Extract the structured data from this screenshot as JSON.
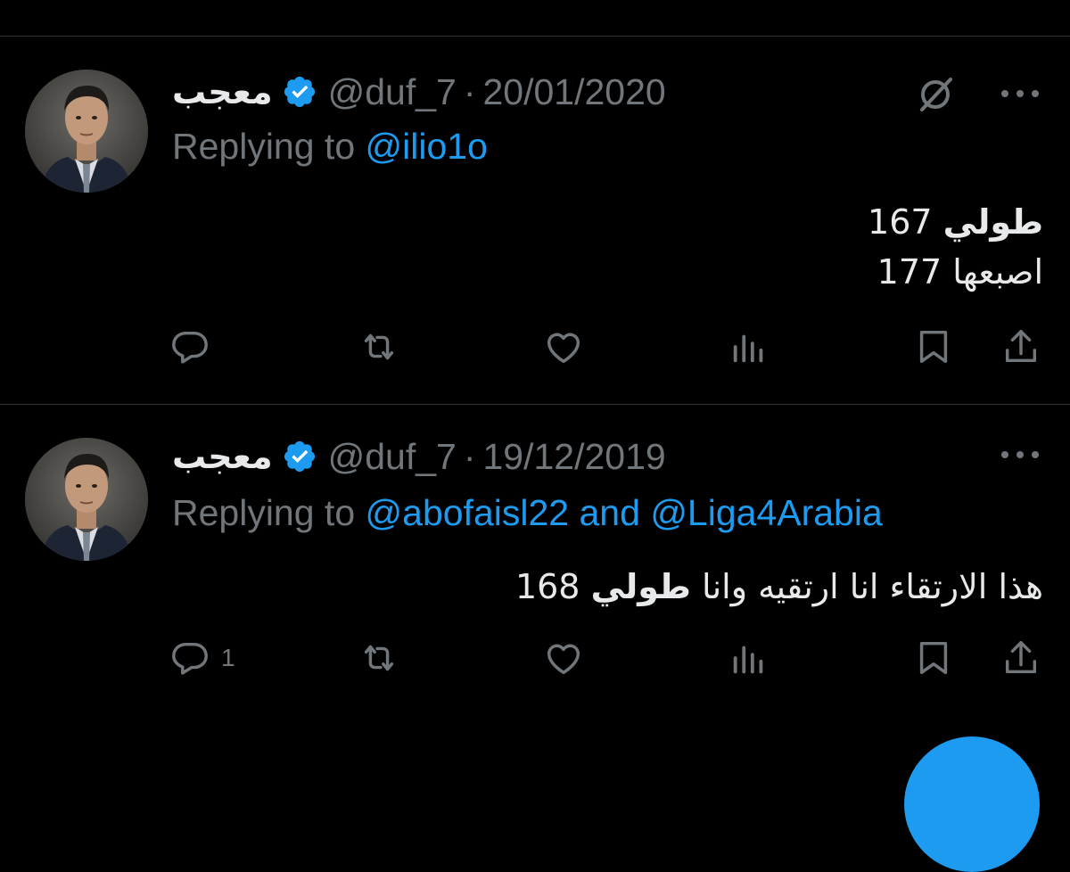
{
  "colors": {
    "background": "#000000",
    "divider": "#2f3336",
    "text_primary": "#e7e9ea",
    "text_secondary": "#71767b",
    "accent": "#1d9bf0"
  },
  "tweets": [
    {
      "display_name": "معجب",
      "handle": "@duf_7",
      "separator": "·",
      "date": "20/01/2020",
      "replying_prefix": "Replying to",
      "mentions": [
        "@ilio1o"
      ],
      "mention_joiner": "",
      "lines": [
        {
          "bold": "طولي",
          "rest": " 167"
        },
        {
          "bold": "",
          "rest": "اصبعها 177"
        }
      ],
      "reply_count": "",
      "icons": [
        "reply-icon",
        "retweet-icon",
        "like-icon",
        "views-icon",
        "bookmark-icon",
        "share-icon",
        "grok-icon",
        "more-icon",
        "verified-icon"
      ]
    },
    {
      "display_name": "معجب",
      "handle": "@duf_7",
      "separator": "·",
      "date": "19/12/2019",
      "replying_prefix": "Replying to",
      "mentions": [
        "@abofaisl22",
        "@Liga4Arabia"
      ],
      "mention_joiner": "and",
      "lines": [
        {
          "plain": "هذا الارتقاء انا ارتقيه وانا ",
          "bold": "طولي",
          "rest": " 168"
        }
      ],
      "reply_count": "1",
      "icons": [
        "reply-icon",
        "retweet-icon",
        "like-icon",
        "views-icon",
        "bookmark-icon",
        "share-icon",
        "more-icon",
        "verified-icon"
      ]
    }
  ]
}
